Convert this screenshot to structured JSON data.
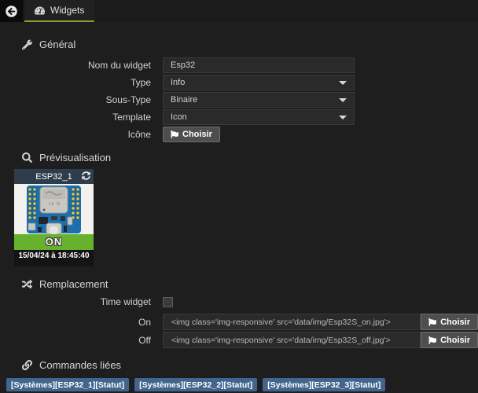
{
  "topbar": {
    "tab_label": "Widgets"
  },
  "sections": {
    "general_title": "Général",
    "preview_title": "Prévisualisation",
    "replacement_title": "Remplacement",
    "commands_title": "Commandes liées"
  },
  "general": {
    "fields": {
      "name": {
        "label": "Nom du widget",
        "value": "Esp32"
      },
      "type": {
        "label": "Type",
        "value": "Info"
      },
      "subtype": {
        "label": "Sous-Type",
        "value": "Binaire"
      },
      "template": {
        "label": "Template",
        "value": "Icon"
      },
      "icon": {
        "label": "Icône",
        "button": "Choisir"
      }
    }
  },
  "preview": {
    "widget_title": "ESP32_1",
    "state": "ON",
    "timestamp": "15/04/24 à 18:45:40"
  },
  "replacement": {
    "time_widget_label": "Time widget",
    "on": {
      "label": "On",
      "value": "<img class='img-responsive' src='data/img/Esp32S_on.jpg'>",
      "button": "Choisir"
    },
    "off": {
      "label": "Off",
      "value": "<img class='img-responsive' src='data/img/Esp32S_off.jpg'>",
      "button": "Choisir"
    }
  },
  "commands": {
    "items": [
      "[Systèmes][ESP32_1][Statut]",
      "[Systèmes][ESP32_2][Statut]",
      "[Systèmes][ESP32_3][Statut]"
    ]
  },
  "colors": {
    "tab_underline": "#8d9a2e",
    "widget_header": "#2e3d4c",
    "state_on_green": "#67b12c",
    "badge_blue": "#41658c",
    "board_blue": "#1b6fad"
  }
}
